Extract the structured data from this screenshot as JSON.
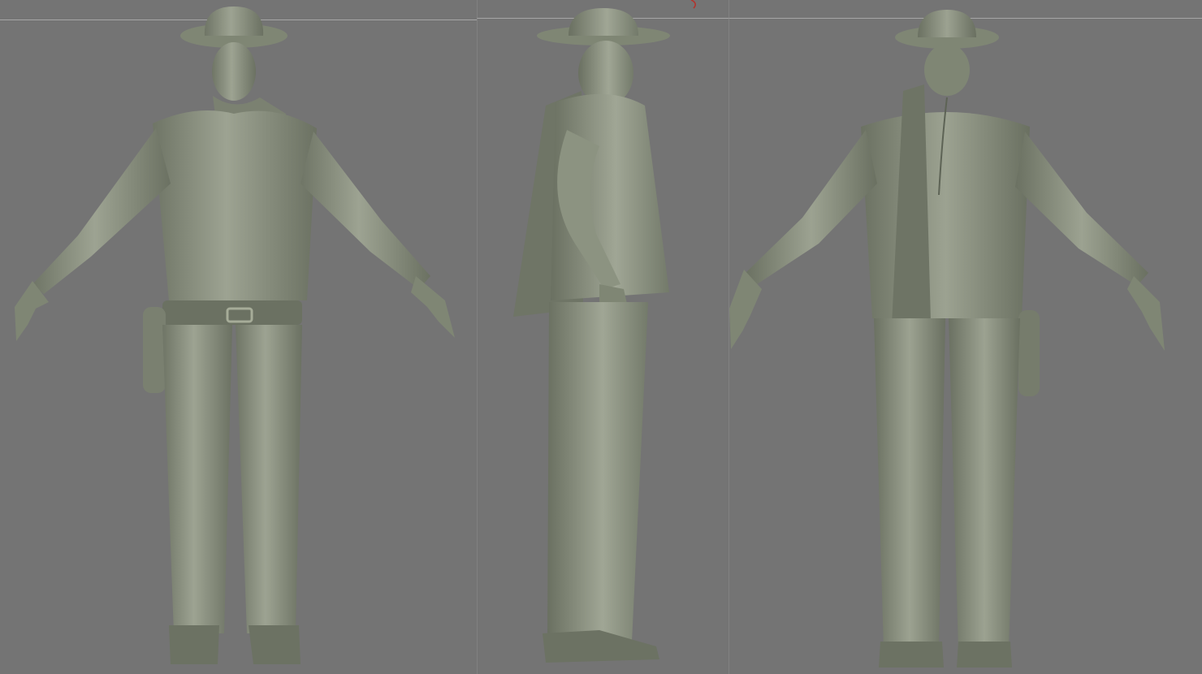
{
  "viewport": {
    "background": "#747474",
    "sculpt_color": "#8a917f",
    "sculpt_shadow": "#5d6355",
    "sculpt_highlight": "#b3b9a6",
    "guide_color": "#b7b7b7",
    "accent_mark_color": "#b3332c"
  },
  "views": [
    {
      "id": "front",
      "icon": "character-front-view-icon"
    },
    {
      "id": "side",
      "icon": "character-side-view-icon"
    },
    {
      "id": "back",
      "icon": "character-back-view-icon"
    }
  ]
}
